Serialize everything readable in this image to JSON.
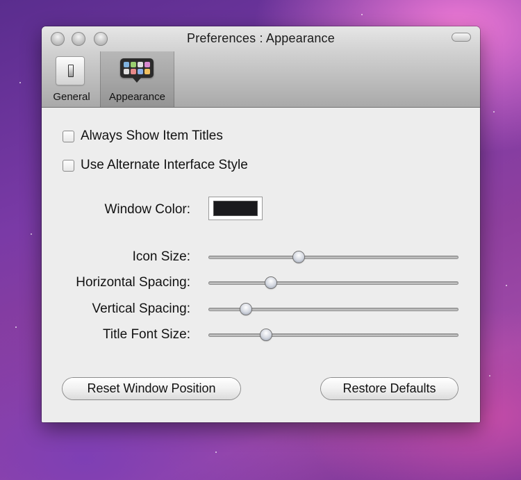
{
  "window": {
    "title": "Preferences : Appearance"
  },
  "toolbar": {
    "items": [
      {
        "label": "General",
        "icon": "toggle-switch-icon",
        "selected": false
      },
      {
        "label": "Appearance",
        "icon": "icon-grid-icon",
        "selected": true
      }
    ]
  },
  "appearance": {
    "checkboxes": [
      {
        "label": "Always Show Item Titles",
        "checked": false
      },
      {
        "label": "Use Alternate Interface Style",
        "checked": false
      }
    ],
    "window_color": {
      "label": "Window Color:",
      "value": "#1a1a1d"
    },
    "sliders": [
      {
        "label": "Icon Size:",
        "value": 0.36
      },
      {
        "label": "Horizontal Spacing:",
        "value": 0.25
      },
      {
        "label": "Vertical Spacing:",
        "value": 0.15
      },
      {
        "label": "Title Font Size:",
        "value": 0.23
      }
    ],
    "buttons": {
      "reset_label": "Reset Window Position",
      "restore_label": "Restore Defaults"
    }
  }
}
